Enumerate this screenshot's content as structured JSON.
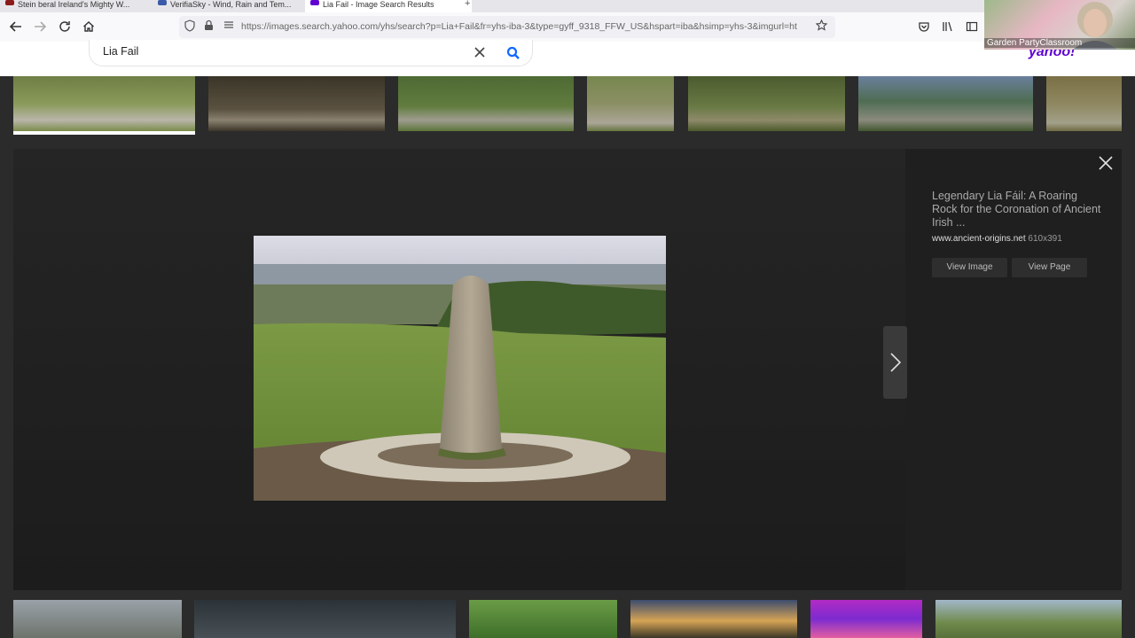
{
  "browser": {
    "tabs": [
      {
        "label": "Stein beral Ireland's Mighty W...",
        "fav_color": "#8b1a1a"
      },
      {
        "label": "VerifiaSky - Wind, Rain and Tem...",
        "fav_color": "#3b5ba8"
      },
      {
        "label": "Lia Fail - Image Search Results",
        "fav_color": "#6001d2"
      }
    ],
    "url": "https://images.search.yahoo.com/yhs/search?p=Lia+Fail&fr=yhs-iba-3&type=gyff_9318_FFW_US&hspart=iba&hsimp=yhs-3&imgurl=ht"
  },
  "search": {
    "query": "Lia Fail",
    "logo": "yahoo!"
  },
  "viewer": {
    "title": "Legendary Lia Fáil: A Roaring Rock for the Coronation of Ancient Irish ...",
    "source": "www.ancient-origins.net",
    "dimensions": "610x391",
    "view_image": "View Image",
    "view_page": "View Page"
  },
  "webcam": {
    "label": "Garden PartyClassroom"
  }
}
